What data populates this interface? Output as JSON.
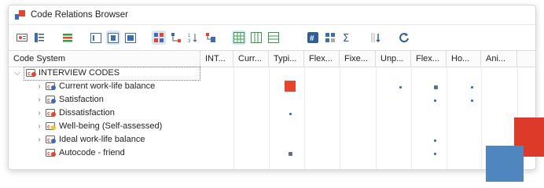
{
  "window": {
    "title": "Code Relations Browser"
  },
  "toolbar": {
    "icons": [
      "card-icon",
      "list-icon",
      "color-bars-icon",
      "panel-left-icon",
      "panel-center-icon",
      "panel-full-icon",
      "tree-grid-icon",
      "tree-branch-icon",
      "sort-numeric-icon",
      "hierarchy-icon",
      "grid-active-icon",
      "columns-icon",
      "rows-icon",
      "hash-icon",
      "matrix-icon",
      "sigma-icon",
      "sort-down-icon",
      "refresh-icon"
    ]
  },
  "grid": {
    "first_col_header": "Code System",
    "columns": [
      "INT...",
      "Curr...",
      "Typi...",
      "Flex...",
      "Fixe...",
      "Unp...",
      "Flex...",
      "Ho...",
      "Ani..."
    ],
    "root": {
      "label": "INTERVIEW CODES"
    },
    "rows": [
      {
        "label": "Current work-life balance",
        "expandable": true
      },
      {
        "label": "Satisfaction",
        "expandable": true
      },
      {
        "label": "Dissatisfaction",
        "expandable": true
      },
      {
        "label": "Well-being (Self-assessed)",
        "expandable": true
      },
      {
        "label": "Ideal work-life balance",
        "expandable": true
      },
      {
        "label": "Autocode - friend",
        "expandable": false
      }
    ]
  },
  "colors": {
    "accent_red": "#e8432d",
    "accent_blue": "#3a6db5",
    "selection": "#d7e6f5"
  }
}
